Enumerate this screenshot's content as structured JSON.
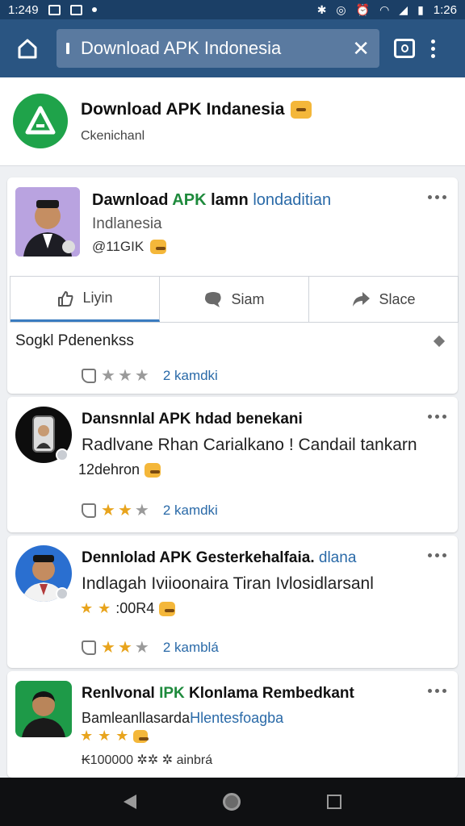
{
  "status_bar": {
    "time_left": "1:249",
    "time_right": "1:26"
  },
  "browser": {
    "url": "Download APK Indonesia",
    "clear_glyph": "✕"
  },
  "header": {
    "title": "Download APK Indanesia",
    "subtitle": "Ckenichanl"
  },
  "post1": {
    "title_a": "Dawnload ",
    "title_b": "APK",
    "title_c": " lamn ",
    "title_d": "londaditian",
    "subtitle": "Indlanesia",
    "meta": "@11GIK",
    "actions": [
      "Liyin",
      "Siam",
      "Slace"
    ],
    "section_label": "Sogkl Pdenenkss",
    "rating_stars": 3,
    "rating_filled": 0,
    "count": "2 kamdki"
  },
  "post2": {
    "title": "Dansnnlal APK hdad benekani",
    "body": "Radlvane Rhan Carialkano ! Candail tankarn",
    "line2": "12dehron",
    "rating_stars": 3,
    "rating_filled": 2,
    "count": "2 kamdki"
  },
  "post3": {
    "title_a": "Dennlolad APK Gesterkehalfaia. ",
    "title_b": "dlana",
    "body": "Indlagah Iviioonaira Tiran Ivlosidlarsanl",
    "line2": ":00R4",
    "line2_stars": 2,
    "rating_stars": 3,
    "rating_filled": 2,
    "count": "2 kamblá"
  },
  "post4": {
    "title_a": "Renlvonal ",
    "title_b": "IPK",
    "title_c": " Klonlama Rembedkant",
    "body_a": "Bamleanllasarda",
    "body_b": "Hlentesfoagba",
    "line2_stars": 3,
    "meta": "₭100000 ✲✲ ✲ ainbrá"
  },
  "colors": {
    "status_bar": "#1b3f66",
    "url_bar": "#2a5582",
    "accent_green": "#1e8a3c",
    "link_blue": "#2a6aa8",
    "star": "#e8a41d"
  },
  "icons": [
    "home-icon",
    "info-icon",
    "close-icon",
    "tabs-icon",
    "menu-icon",
    "more-icon",
    "like-icon",
    "comment-icon",
    "share-icon",
    "pencil-icon",
    "star-icon",
    "thumb-icon",
    "back-icon",
    "nav-home-icon",
    "recents-icon"
  ]
}
